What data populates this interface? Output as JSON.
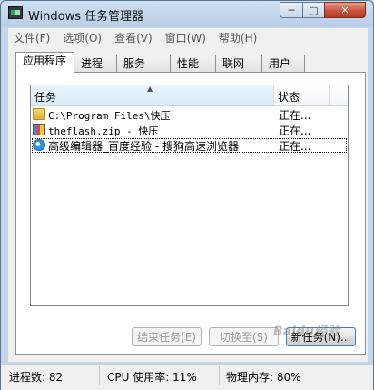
{
  "window": {
    "title": "Windows 任务管理器",
    "controls": {
      "minimize": "─",
      "maximize": "▢",
      "close": "✕"
    }
  },
  "menu": [
    "文件(F)",
    "选项(O)",
    "查看(V)",
    "窗口(W)",
    "帮助(H)"
  ],
  "tabs": [
    "应用程序",
    "进程",
    "服务",
    "性能",
    "联网",
    "用户"
  ],
  "active_tab": "应用程序",
  "list": {
    "sort_indicator": "▲",
    "columns": {
      "task": "任务",
      "status": "状态"
    },
    "rows": [
      {
        "name": "C:\\Program Files\\快压",
        "status": "正在...",
        "icon": "folder-icon"
      },
      {
        "name": "theflash.zip - 快压",
        "status": "正在...",
        "icon": "zip-archive-icon"
      },
      {
        "name": "高级编辑器_百度经验 - 搜狗高速浏览器",
        "status": "正在...",
        "icon": "browser-icon",
        "selected": true
      }
    ]
  },
  "buttons": {
    "end_task": "结束任务(E)",
    "switch_to": "切换至(S)",
    "new_task": "新任务(N)..."
  },
  "statusbar": {
    "processes": "进程数: 82",
    "cpu": "CPU 使用率: 11%",
    "memory": "物理内存: 80%"
  },
  "watermark": "Baidu经验"
}
